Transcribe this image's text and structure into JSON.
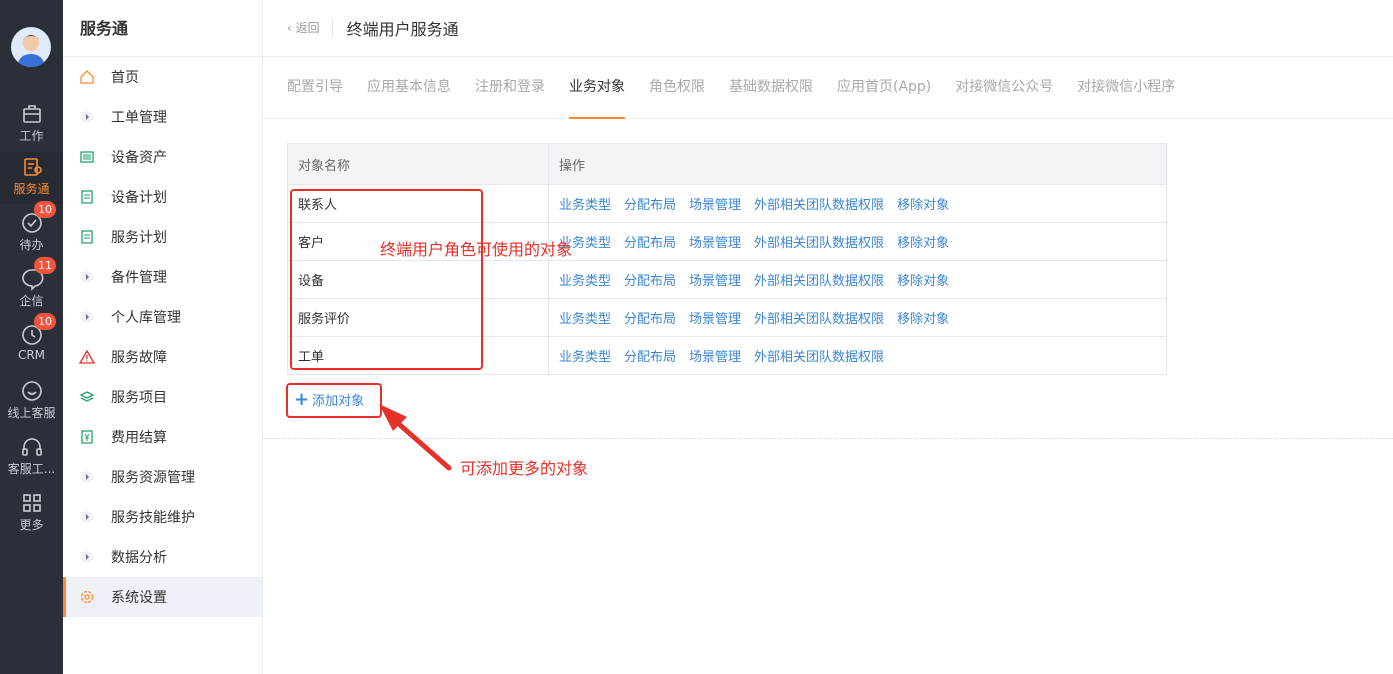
{
  "rail": {
    "items": [
      {
        "label": "工作",
        "icon": "briefcase-icon"
      },
      {
        "label": "服务通",
        "icon": "service-icon"
      },
      {
        "label": "待办",
        "icon": "check-circle-icon",
        "badge": "10"
      },
      {
        "label": "企信",
        "icon": "chat-icon",
        "badge": "11"
      },
      {
        "label": "CRM",
        "icon": "clock-icon",
        "badge": "10"
      },
      {
        "label": "线上客服",
        "icon": "smile-icon"
      },
      {
        "label": "客服工...",
        "icon": "headset-icon"
      },
      {
        "label": "更多",
        "icon": "grid-icon"
      }
    ]
  },
  "sidebar": {
    "title": "服务通",
    "items": [
      {
        "label": "首页",
        "icon": "home-icon"
      },
      {
        "label": "工单管理",
        "icon": "caret-right-icon"
      },
      {
        "label": "设备资产",
        "icon": "device-icon"
      },
      {
        "label": "设备计划",
        "icon": "document-icon"
      },
      {
        "label": "服务计划",
        "icon": "document-icon"
      },
      {
        "label": "备件管理",
        "icon": "caret-right-icon"
      },
      {
        "label": "个人库管理",
        "icon": "caret-right-icon"
      },
      {
        "label": "服务故障",
        "icon": "warning-icon"
      },
      {
        "label": "服务项目",
        "icon": "layers-icon"
      },
      {
        "label": "费用结算",
        "icon": "yuan-icon"
      },
      {
        "label": "服务资源管理",
        "icon": "caret-right-icon"
      },
      {
        "label": "服务技能维护",
        "icon": "caret-right-icon"
      },
      {
        "label": "数据分析",
        "icon": "caret-right-icon"
      },
      {
        "label": "系统设置",
        "icon": "gear-icon"
      }
    ]
  },
  "header": {
    "back": "返回",
    "title": "终端用户服务通"
  },
  "tabs": [
    "配置引导",
    "应用基本信息",
    "注册和登录",
    "业务对象",
    "角色权限",
    "基础数据权限",
    "应用首页(App)",
    "对接微信公众号",
    "对接微信小程序"
  ],
  "table": {
    "headers": [
      "对象名称",
      "操作"
    ],
    "rows": [
      {
        "name": "联系人",
        "ops": [
          "业务类型",
          "分配布局",
          "场景管理",
          "外部相关团队数据权限",
          "移除对象"
        ]
      },
      {
        "name": "客户",
        "ops": [
          "业务类型",
          "分配布局",
          "场景管理",
          "外部相关团队数据权限",
          "移除对象"
        ]
      },
      {
        "name": "设备",
        "ops": [
          "业务类型",
          "分配布局",
          "场景管理",
          "外部相关团队数据权限",
          "移除对象"
        ]
      },
      {
        "name": "服务评价",
        "ops": [
          "业务类型",
          "分配布局",
          "场景管理",
          "外部相关团队数据权限",
          "移除对象"
        ]
      },
      {
        "name": "工单",
        "ops": [
          "业务类型",
          "分配布局",
          "场景管理",
          "外部相关团队数据权限"
        ]
      }
    ]
  },
  "add_object": "添加对象",
  "annotations": {
    "objects_note": "终端用户角色可使用的对象",
    "add_note": "可添加更多的对象"
  },
  "colors": {
    "accent": "#ff8a2b",
    "link": "#3b87d6",
    "annotation": "#e8302b",
    "rail": "#2b2f38"
  }
}
